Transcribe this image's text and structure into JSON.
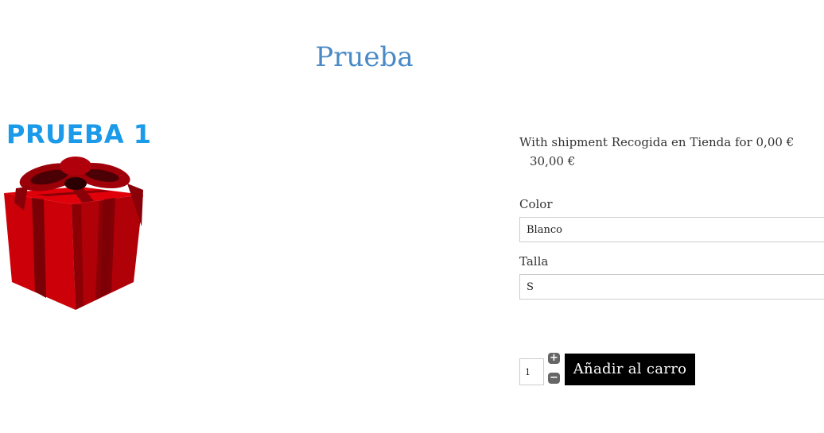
{
  "product": {
    "title": "Prueba",
    "image": {
      "heading_text": "PRUEBA 1",
      "icon": "gift-box-icon",
      "colors": {
        "heading": "#1a9ae8",
        "box": "#d8000a",
        "ribbon": "#8a0008"
      }
    },
    "shipment_text": "With shipment Recogida en Tienda for 0,00 €",
    "price": "30,00 €"
  },
  "attributes": {
    "color": {
      "label": "Color",
      "selected": "Blanco"
    },
    "talla": {
      "label": "Talla",
      "selected": "S"
    }
  },
  "cart": {
    "quantity": "1",
    "plus_label": "+",
    "minus_label": "−",
    "add_button_label": "Añadir al carro"
  },
  "theme": {
    "title_color": "#4a8ac6",
    "button_bg": "#000000",
    "button_text": "#ffffff"
  }
}
